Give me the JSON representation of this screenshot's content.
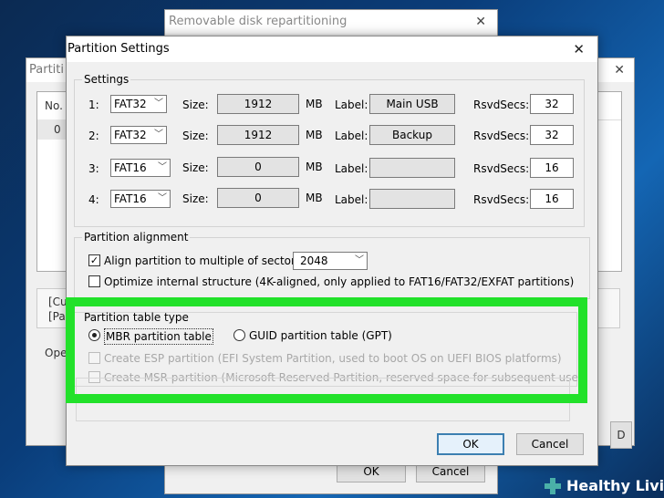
{
  "background_windows": {
    "back_title": "Removable disk repartitioning",
    "left_title": "Partiti",
    "list_header_no": "No.",
    "list_row0": "0",
    "status_line1": "[Cu",
    "status_line2": "[Pa",
    "ope_label": "Ope",
    "btn_d": "D",
    "ok_label": "OK",
    "cancel_label": "Cancel"
  },
  "dialog": {
    "title": "Partition Settings",
    "close_glyph": "✕",
    "settings_label": "Settings",
    "size_label": "Size:",
    "mb_label": "MB",
    "label_label": "Label:",
    "rsvd_label": "RsvdSecs:",
    "partitions": [
      {
        "num": "1:",
        "fs": "FAT32",
        "size": "1912",
        "label": "Main USB",
        "rsvd": "32"
      },
      {
        "num": "2:",
        "fs": "FAT32",
        "size": "1912",
        "label": "Backup",
        "rsvd": "32"
      },
      {
        "num": "3:",
        "fs": "FAT16",
        "size": "0",
        "label": "",
        "rsvd": "16"
      },
      {
        "num": "4:",
        "fs": "FAT16",
        "size": "0",
        "label": "",
        "rsvd": "16"
      }
    ],
    "alignment": {
      "group_label": "Partition alignment",
      "align_label": "Align partition to multiple of sectors:",
      "align_checked": true,
      "sectors_value": "2048",
      "optimize_label": "Optimize internal structure (4K-aligned, only applied to FAT16/FAT32/EXFAT partitions)",
      "optimize_checked": false
    },
    "table_type": {
      "group_label": "Partition table type",
      "mbr_label": "MBR partition table",
      "gpt_label": "GUID partition table (GPT)",
      "selected": "MBR",
      "esp_label": "Create ESP partition (EFI System Partition, used to boot OS on UEFI BIOS platforms)",
      "msr_label": "Create MSR partition (Microsoft Reserved Partition, reserved space for subsequent use)"
    },
    "ok_label": "OK",
    "cancel_label": "Cancel"
  },
  "highlight_color": "#22e12a",
  "logo": {
    "text": "Healthy Living",
    "icon": "plus-icon",
    "color": "#4ab0a8"
  }
}
